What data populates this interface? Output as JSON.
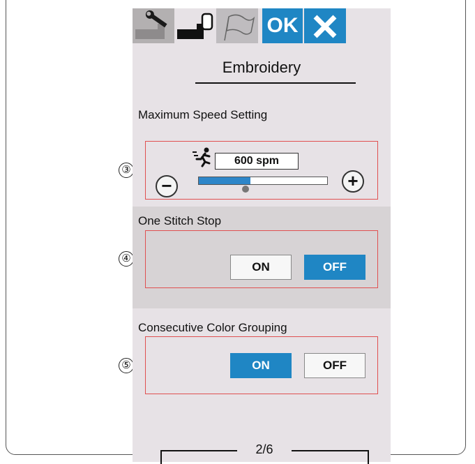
{
  "tabs": {
    "setup_icon": "wrench-machine-icon",
    "embroidery_icon": "embroidery-machine-icon",
    "language_icon": "flag-icon",
    "ok_label": "OK",
    "close_icon": "close-icon"
  },
  "screen_title": "Embroidery",
  "max_speed": {
    "label": "Maximum Speed Setting",
    "value": "600 spm",
    "level_fraction": 0.4,
    "minus_icon": "minus-icon",
    "plus_icon": "plus-icon",
    "runner_icon": "running-person-icon"
  },
  "one_stitch_stop": {
    "label": "One Stitch Stop",
    "on_label": "ON",
    "off_label": "OFF",
    "selected": "OFF"
  },
  "consecutive_color_grouping": {
    "label": "Consecutive Color Grouping",
    "on_label": "ON",
    "off_label": "OFF",
    "selected": "ON"
  },
  "page_indicator": "2/6",
  "callouts": [
    "③",
    "④",
    "⑤"
  ],
  "colors": {
    "accent": "#1f86c4",
    "highlight_box": "#e05050"
  }
}
